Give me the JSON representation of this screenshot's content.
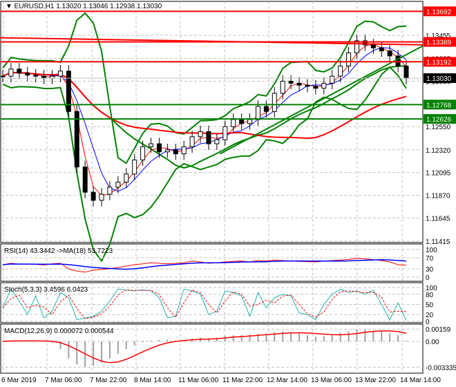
{
  "header": {
    "symbol": "EURUSD,H1",
    "ohlc": "1.13020 1.13046 1.12938 1.13030"
  },
  "colors": {
    "bull": "#000000",
    "bear": "#000000",
    "band": "#008000",
    "resistance": "#ff0000",
    "support": "#008000",
    "current": "#000000",
    "ma_fast": "#ff0000",
    "ma_slow": "#0000ff"
  },
  "chart_data": [
    {
      "type": "candlestick",
      "title": "EURUSD,H1",
      "ylim": [
        1.11415,
        1.13692
      ],
      "ytick_labels": [
        "1.13455",
        "1.13225",
        "1.13000",
        "1.12550",
        "1.12320",
        "1.12095",
        "1.11870",
        "1.11645",
        "1.11415"
      ],
      "yticks": [
        1.13455,
        1.13225,
        1.13,
        1.1255,
        1.1232,
        1.12095,
        1.1187,
        1.11645,
        1.11415
      ],
      "xtick_labels": [
        "6 Mar 2019",
        "7 Mar 06:00",
        "7 Mar 22:00",
        "8 Mar 14:00",
        "11 Mar 06:00",
        "11 Mar 22:00",
        "12 Mar 14:00",
        "13 Mar 06:00",
        "13 Mar 22:00",
        "14 Mar 14:00"
      ],
      "close": [
        1.1305,
        1.1312,
        1.1308,
        1.1306,
        1.1305,
        1.1303,
        1.1305,
        1.131,
        1.127,
        1.1215,
        1.119,
        1.1182,
        1.1188,
        1.1195,
        1.12,
        1.1208,
        1.1222,
        1.1235,
        1.1238,
        1.123,
        1.1232,
        1.1228,
        1.1235,
        1.1245,
        1.125,
        1.1238,
        1.1242,
        1.1255,
        1.1262,
        1.1258,
        1.1262,
        1.1275,
        1.127,
        1.1288,
        1.13,
        1.1298,
        1.1296,
        1.1295,
        1.1293,
        1.1298,
        1.1305,
        1.1315,
        1.1328,
        1.134,
        1.1336,
        1.1333,
        1.133,
        1.1325,
        1.1315,
        1.1303
      ],
      "levels": [
        {
          "price": 1.13692,
          "label": "1.13692",
          "kind": "resistance"
        },
        {
          "price": 1.13389,
          "label": "1.13389",
          "kind": "resistance"
        },
        {
          "price": 1.13192,
          "label": "1.13192",
          "kind": "resistance"
        },
        {
          "price": 1.1303,
          "label": "1.13030",
          "kind": "current"
        },
        {
          "price": 1.12768,
          "label": "1.12768",
          "kind": "support"
        },
        {
          "price": 1.12626,
          "label": "1.12626",
          "kind": "support"
        }
      ],
      "trendlines": [
        {
          "kind": "resistance",
          "from": [
            0,
            1.1343
          ],
          "to": [
            1,
            1.1336
          ]
        },
        {
          "kind": "support",
          "from": [
            0.52,
            1.1228
          ],
          "to": [
            1,
            1.1335
          ]
        }
      ]
    },
    {
      "type": "line",
      "title": "RSI(14) 43.3442  ->MA(18) 53.7223",
      "ylim": [
        0,
        100
      ],
      "ytick_labels": [
        "100",
        "70",
        "30",
        "0"
      ],
      "yticks": [
        100,
        70,
        30,
        0
      ],
      "series": [
        {
          "name": "RSI",
          "values": [
            45,
            50,
            47,
            47,
            46,
            44,
            48,
            50,
            30,
            22,
            18,
            25,
            28,
            30,
            35,
            40,
            45,
            48,
            52,
            50,
            48,
            50,
            52,
            58,
            55,
            50,
            52,
            55,
            57,
            58,
            55,
            60,
            58,
            62,
            60,
            58,
            57,
            56,
            55,
            58,
            60,
            62,
            64,
            68,
            66,
            63,
            60,
            55,
            45,
            43
          ]
        }
      ]
    },
    {
      "type": "line",
      "title": "Stoch(5,3,3) 3.4596 6.0423",
      "ylim": [
        0,
        100
      ],
      "ytick_labels": [
        "100",
        "80",
        "50",
        "20",
        "0"
      ],
      "yticks": [
        100,
        80,
        50,
        20,
        0
      ],
      "series": [
        {
          "name": "Main",
          "values": [
            40,
            95,
            60,
            20,
            75,
            10,
            30,
            85,
            70,
            5,
            10,
            15,
            30,
            60,
            95,
            92,
            90,
            93,
            90,
            70,
            10,
            15,
            95,
            90,
            80,
            20,
            30,
            90,
            85,
            75,
            15,
            85,
            40,
            70,
            80,
            75,
            25,
            20,
            5,
            50,
            80,
            95,
            85,
            90,
            80,
            92,
            50,
            5,
            55,
            3
          ]
        }
      ]
    },
    {
      "type": "bar",
      "title": "MACD(12,26,9) 0.000072 0.000544",
      "ylim": [
        -0.003335,
        0.00159
      ],
      "ytick_labels": [
        "0.00159",
        "0.00",
        "-0.003335"
      ],
      "yticks": [
        0.00159,
        0,
        -0.003335
      ],
      "series": [
        {
          "name": "MACD",
          "values": [
            0,
            0.0001,
            0.0001,
            0.0001,
            0,
            0,
            -0.0002,
            -0.001,
            -0.0022,
            -0.003,
            -0.0033,
            -0.0031,
            -0.0027,
            -0.0022,
            -0.0016,
            -0.001,
            -0.0005,
            -0.0001,
            0.0001,
            0.0002,
            0.0002,
            0.0001,
            0.0002,
            0.0004,
            0.0005,
            0.0004,
            0.0005,
            0.0007,
            0.0008,
            0.0008,
            0.0009,
            0.001,
            0.001,
            0.0012,
            0.0013,
            0.0012,
            0.001,
            0.0008,
            0.0006,
            0.0007,
            0.0009,
            0.0011,
            0.0013,
            0.0015,
            0.0015,
            0.0014,
            0.0013,
            0.0011,
            0.0008,
            0.0001
          ]
        }
      ]
    }
  ]
}
